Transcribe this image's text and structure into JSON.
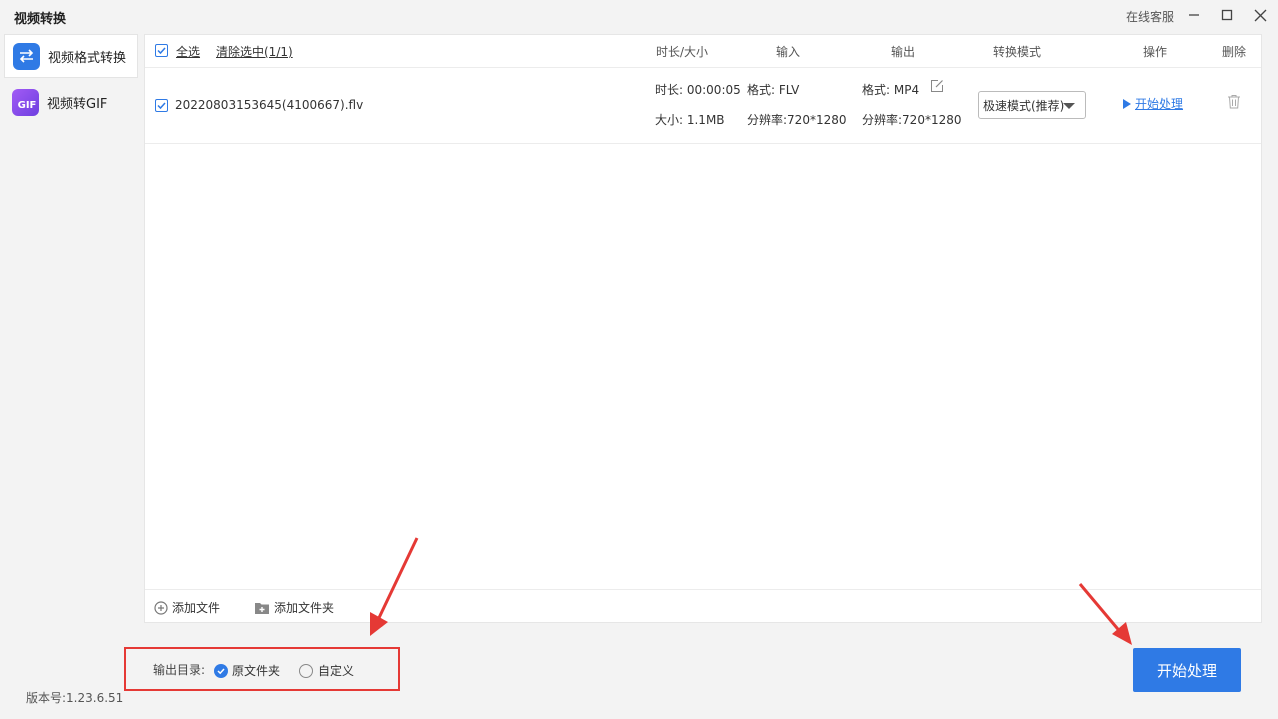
{
  "app": {
    "title": "视频转换",
    "online_service": "在线客服"
  },
  "sidebar": {
    "items": [
      {
        "label": "视频格式转换",
        "icon": "swap-arrows-icon",
        "active": true
      },
      {
        "label": "视频转GIF",
        "icon": "gif-icon",
        "active": false
      }
    ],
    "gif_icon_text": "GIF"
  },
  "toolbar": {
    "select_all": "全选",
    "clear_selected": "清除选中(1/1)"
  },
  "columns": {
    "duration_size": "时长/大小",
    "input": "输入",
    "output": "输出",
    "convert_mode": "转换模式",
    "action": "操作",
    "delete": "删除"
  },
  "files": [
    {
      "name": "20220803153645(4100667).flv",
      "duration": "时长: 00:00:05",
      "size": "大小: 1.1MB",
      "input_format": "格式: FLV",
      "input_resolution": "分辨率:720*1280",
      "output_format": "格式: MP4",
      "output_resolution": "分辨率:720*1280",
      "mode": "极速模式(推荐)",
      "action": "开始处理",
      "checked": true
    }
  ],
  "footer": {
    "add_file": "添加文件",
    "add_folder": "添加文件夹"
  },
  "output_dir": {
    "label": "输出目录:",
    "option_original": "原文件夹",
    "option_custom": "自定义",
    "selected": "原文件夹"
  },
  "start_button": "开始处理",
  "version": "版本号:1.23.6.51",
  "colors": {
    "accent": "#2f7ae5",
    "annotation_red": "#e53935",
    "gif_purple": "#8e44ec"
  }
}
